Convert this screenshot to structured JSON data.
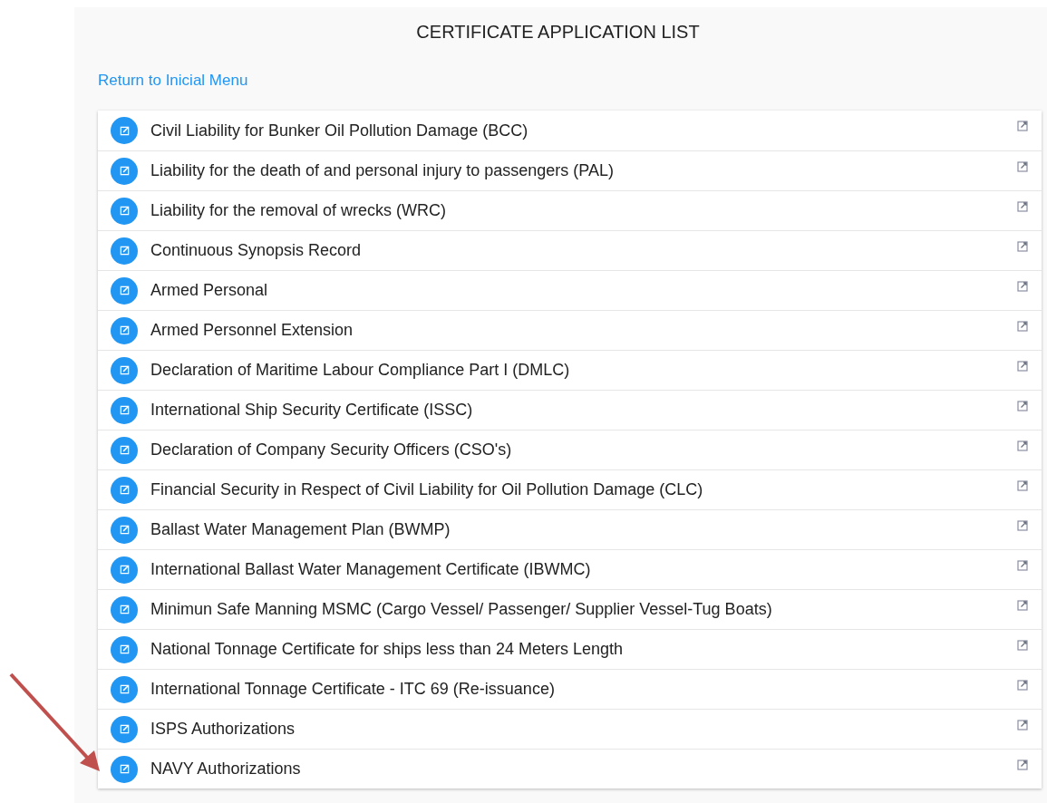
{
  "title": "CERTIFICATE APPLICATION LIST",
  "return_link": "Return to Inicial Menu",
  "certificates": [
    {
      "label": "Civil Liability for Bunker Oil Pollution Damage (BCC)"
    },
    {
      "label": "Liability for the death of and personal injury to passengers (PAL)"
    },
    {
      "label": "Liability for the removal of wrecks (WRC)"
    },
    {
      "label": "Continuous Synopsis Record"
    },
    {
      "label": "Armed Personal"
    },
    {
      "label": "Armed Personnel Extension"
    },
    {
      "label": "Declaration of Maritime Labour Compliance Part I (DMLC)"
    },
    {
      "label": "International Ship Security Certificate (ISSC)"
    },
    {
      "label": "Declaration of Company Security Officers (CSO's)"
    },
    {
      "label": "Financial Security in Respect of Civil Liability for Oil Pollution Damage (CLC)"
    },
    {
      "label": "Ballast Water Management Plan (BWMP)"
    },
    {
      "label": "International Ballast Water Management Certificate (IBWMC)"
    },
    {
      "label": "Minimun Safe Manning MSMC (Cargo Vessel/ Passenger/ Supplier Vessel-Tug Boats)"
    },
    {
      "label": "National Tonnage Certificate for ships less than 24 Meters Length"
    },
    {
      "label": "International Tonnage Certificate - ITC 69 (Re-issuance)"
    },
    {
      "label": "ISPS Authorizations"
    },
    {
      "label": "NAVY Authorizations"
    }
  ]
}
